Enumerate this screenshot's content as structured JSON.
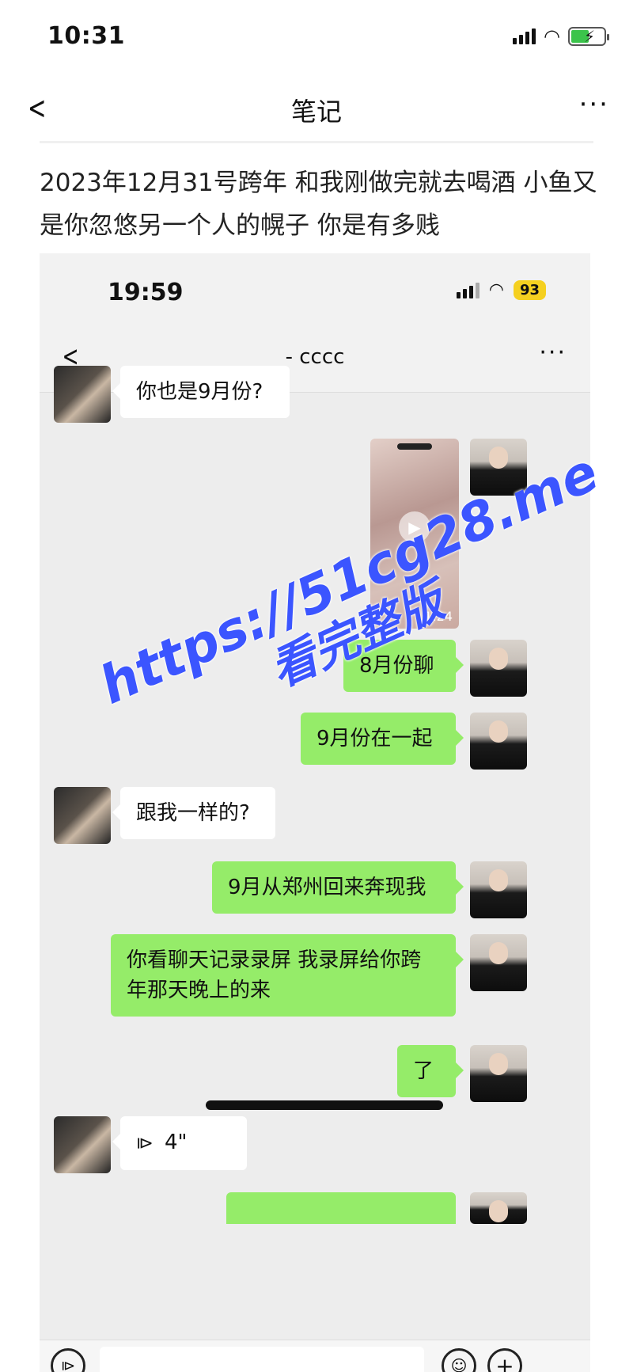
{
  "status_bar": {
    "time": "10:31"
  },
  "nav": {
    "title": "笔记"
  },
  "note": {
    "text": "2023年12月31号跨年 和我刚做完就去喝酒 小鱼又是你忽悠另一个人的幌子 你是有多贱"
  },
  "screenshot": {
    "status_bar": {
      "time": "19:59",
      "battery": "93"
    },
    "nav": {
      "title": "- cccc"
    },
    "messages": [
      {
        "from": "other",
        "type": "text",
        "text": "你也是9月份?"
      },
      {
        "from": "self",
        "type": "video",
        "duration": "1:24"
      },
      {
        "from": "self",
        "type": "text",
        "text": "8月份聊"
      },
      {
        "from": "self",
        "type": "text",
        "text": "9月份在一起"
      },
      {
        "from": "other",
        "type": "text",
        "text": "跟我一样的?"
      },
      {
        "from": "self",
        "type": "text",
        "text": "9月从郑州回来奔现我"
      },
      {
        "from": "self",
        "type": "text",
        "text": "你看聊天记录录屏 我录屏给你跨年那天晚上的来"
      },
      {
        "from": "self",
        "type": "text",
        "text": "了"
      },
      {
        "from": "other",
        "type": "voice",
        "duration": "4\""
      }
    ]
  },
  "watermark": {
    "line1": "https://51cg28.me",
    "line2": "看完整版"
  },
  "colors": {
    "bubble_out": "#95ec69",
    "bubble_in": "#ffffff",
    "watermark": "#3b55ff"
  }
}
